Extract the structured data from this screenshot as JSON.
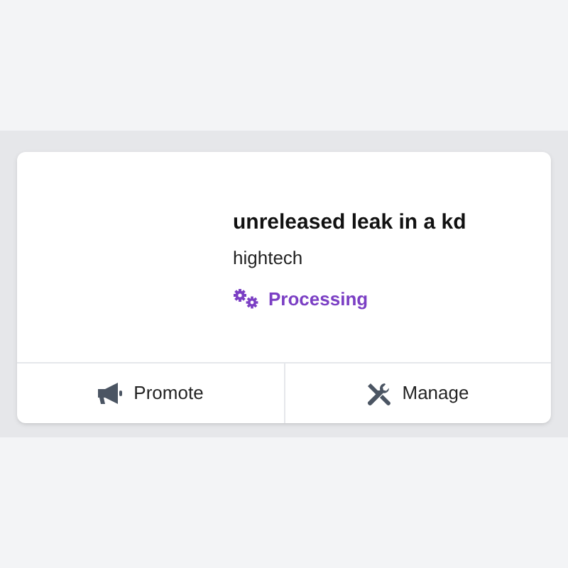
{
  "card": {
    "title": "unreleased leak in a kd",
    "subtitle": "hightech",
    "status": {
      "kind": "processing",
      "label": "Processing"
    }
  },
  "actions": [
    {
      "kind": "promote",
      "label": "Promote"
    },
    {
      "kind": "manage",
      "label": "Manage"
    }
  ]
}
